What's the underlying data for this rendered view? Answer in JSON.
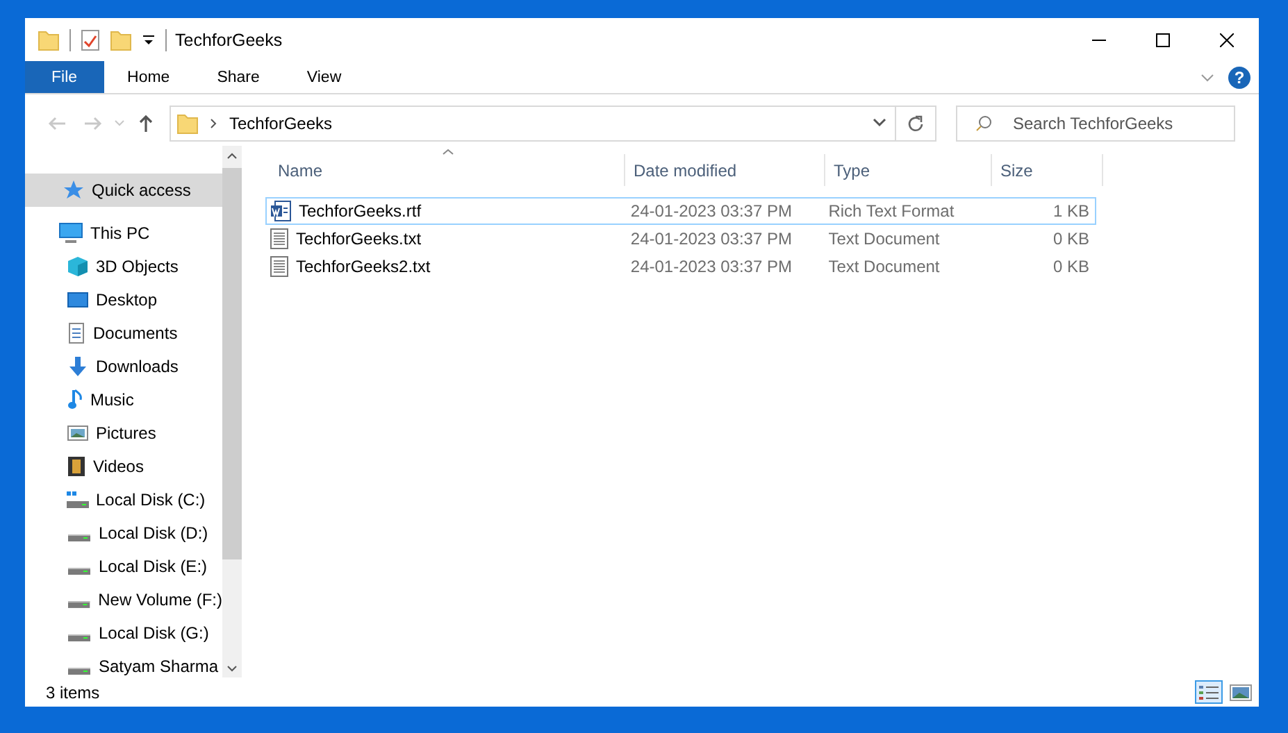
{
  "window": {
    "title": "TechforGeeks"
  },
  "ribbon_tabs": [
    {
      "label": "File",
      "kind": "file",
      "selected": false
    },
    {
      "label": "Home",
      "kind": "tab",
      "selected": false
    },
    {
      "label": "Share",
      "kind": "tab",
      "selected": false
    },
    {
      "label": "View",
      "kind": "tab",
      "selected": false
    }
  ],
  "help_button": {
    "label": "?"
  },
  "address_bar": {
    "path": "TechforGeeks"
  },
  "search": {
    "placeholder": "Search TechforGeeks"
  },
  "sidebar": {
    "items": [
      {
        "label": "Quick access",
        "kind": "star",
        "selected": true
      },
      {
        "label": "This PC",
        "kind": "pc",
        "selected": false,
        "children": [
          {
            "label": "3D Objects",
            "kind": "cube",
            "selected": false
          },
          {
            "label": "Desktop",
            "kind": "desktop",
            "selected": false
          },
          {
            "label": "Documents",
            "kind": "documents",
            "selected": false
          },
          {
            "label": "Downloads",
            "kind": "download",
            "selected": false
          },
          {
            "label": "Music",
            "kind": "music",
            "selected": false
          },
          {
            "label": "Pictures",
            "kind": "pictures",
            "selected": false
          },
          {
            "label": "Videos",
            "kind": "videos",
            "selected": false
          },
          {
            "label": "Local Disk (C:)",
            "kind": "system-drive",
            "selected": false
          },
          {
            "label": "Local Disk (D:)",
            "kind": "drive",
            "selected": false
          },
          {
            "label": "Local Disk (E:)",
            "kind": "drive",
            "selected": false
          },
          {
            "label": "New Volume (F:)",
            "kind": "drive",
            "selected": false
          },
          {
            "label": "Local Disk (G:)",
            "kind": "drive",
            "selected": false
          },
          {
            "label": "Satyam Sharma",
            "kind": "drive",
            "selected": false
          }
        ]
      }
    ]
  },
  "table": {
    "columns": [
      "Name",
      "Date modified",
      "Type",
      "Size"
    ],
    "rows": [
      {
        "kind": "rtf",
        "focused": true,
        "cells": [
          "TechforGeeks.rtf",
          "24-01-2023 03:37 PM",
          "Rich Text Format",
          "1 KB"
        ]
      },
      {
        "kind": "txt",
        "focused": false,
        "cells": [
          "TechforGeeks.txt",
          "24-01-2023 03:37 PM",
          "Text Document",
          "0 KB"
        ]
      },
      {
        "kind": "txt",
        "focused": false,
        "cells": [
          "TechforGeeks2.txt",
          "24-01-2023 03:37 PM",
          "Text Document",
          "0 KB"
        ]
      }
    ]
  },
  "status_bar": {
    "count": "3 items",
    "views": [
      {
        "kind": "details",
        "selected": true
      },
      {
        "kind": "tiles",
        "selected": false
      }
    ]
  }
}
